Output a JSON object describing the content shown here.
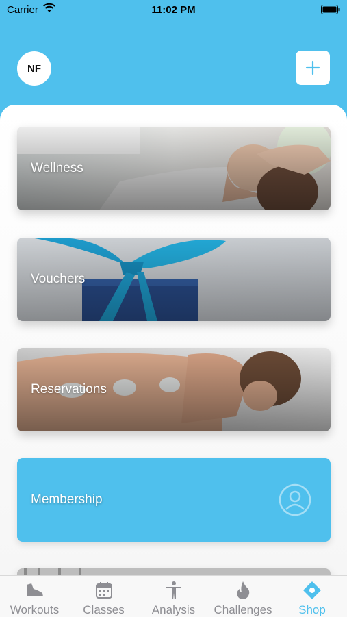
{
  "status_bar": {
    "carrier": "Carrier",
    "time": "11:02 PM"
  },
  "header": {
    "avatar_initials": "NF"
  },
  "cards": [
    {
      "label": "Wellness"
    },
    {
      "label": "Vouchers"
    },
    {
      "label": "Reservations"
    },
    {
      "label": "Membership"
    }
  ],
  "tabs": [
    {
      "label": "Workouts",
      "icon": "shoe-icon"
    },
    {
      "label": "Classes",
      "icon": "calendar-icon"
    },
    {
      "label": "Analysis",
      "icon": "person-icon"
    },
    {
      "label": "Challenges",
      "icon": "flame-icon"
    },
    {
      "label": "Shop",
      "icon": "shop-icon",
      "active": true
    }
  ],
  "colors": {
    "accent": "#4fc0ed",
    "inactive": "#8e8e93"
  }
}
